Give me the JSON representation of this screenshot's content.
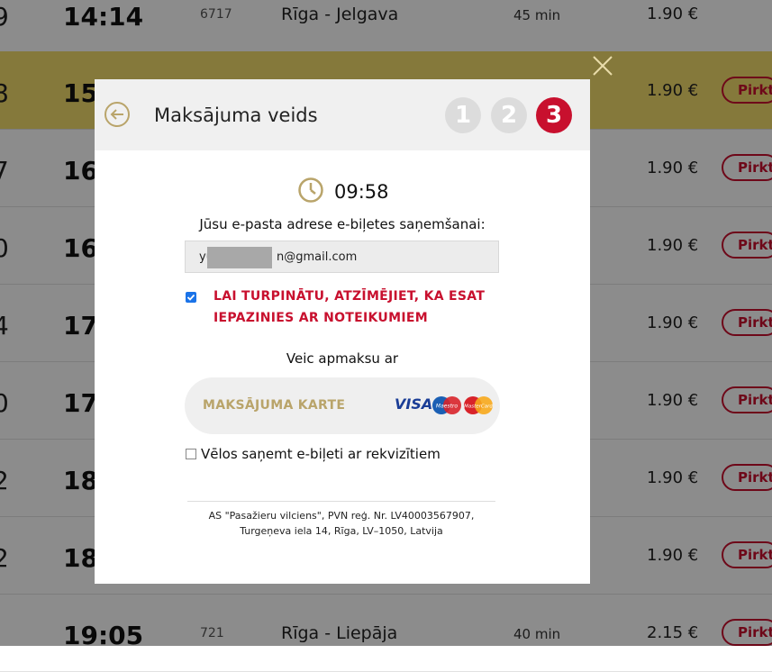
{
  "background": {
    "rows": [
      {
        "idx": "9",
        "time": "14:14",
        "num": "6717",
        "route": "Rīga - Jelgava",
        "dur": "45 min",
        "price": "1.90 €",
        "buy": ""
      },
      {
        "idx": "8",
        "time": "15",
        "num": "",
        "route": "",
        "dur": "",
        "price": "1.90 €",
        "buy": "Pirkt"
      },
      {
        "idx": "7",
        "time": "16",
        "num": "",
        "route": "",
        "dur": "",
        "price": "1.90 €",
        "buy": "Pirkt"
      },
      {
        "idx": "0",
        "time": "16",
        "num": "",
        "route": "",
        "dur": "",
        "price": "1.90 €",
        "buy": "Pirkt"
      },
      {
        "idx": "4",
        "time": "17",
        "num": "",
        "route": "",
        "dur": "",
        "price": "1.90 €",
        "buy": "Pirkt"
      },
      {
        "idx": "0",
        "time": "17",
        "num": "",
        "route": "",
        "dur": "",
        "price": "1.90 €",
        "buy": "Pirkt"
      },
      {
        "idx": "2",
        "time": "18",
        "num": "",
        "route": "",
        "dur": "",
        "price": "1.90 €",
        "buy": "Pirkt"
      },
      {
        "idx": "2",
        "time": "18",
        "num": "",
        "route": "",
        "dur": "",
        "price": "1.90 €",
        "buy": "Pirkt"
      },
      {
        "idx": "",
        "time": "19:05",
        "num": "721",
        "route": "Rīga - Liepāja",
        "dur": "40 min",
        "price": "2.15 €",
        "buy": "Pirkt"
      }
    ]
  },
  "modal": {
    "title": "Maksājuma veids",
    "steps": [
      "1",
      "2",
      "3"
    ],
    "active_step": "3",
    "timer": "09:58",
    "email_label": "Jūsu e-pasta adrese e-biļetes saņemšanai:",
    "email_prefix": "yu",
    "email_suffix": "n@gmail.com",
    "terms_text": "LAI TURPINĀTU, ATZĪMĒJIET, KA ESAT IEPAZINIES AR NOTEIKUMIEM",
    "terms_checked": true,
    "pay_label": "Veic apmaksu ar",
    "pay_card_label": "MAKSĀJUMA KARTE",
    "card_brands": {
      "visa": "VISA",
      "maestro": "Maestro",
      "mastercard": "MasterCard"
    },
    "requisites_label": "Vēlos saņemt e-biļeti ar rekvizītiem",
    "requisites_checked": false,
    "company_line1": "AS \"Pasažieru vilciens\", PVN reģ. Nr. LV40003567907,",
    "company_line2": "Turgeņeva iela 14, Rīga, LV–1050, Latvija"
  },
  "colors": {
    "accent_red": "#c8102e",
    "gold": "#b9a46a",
    "highlight_row": "#f3dc6c"
  }
}
